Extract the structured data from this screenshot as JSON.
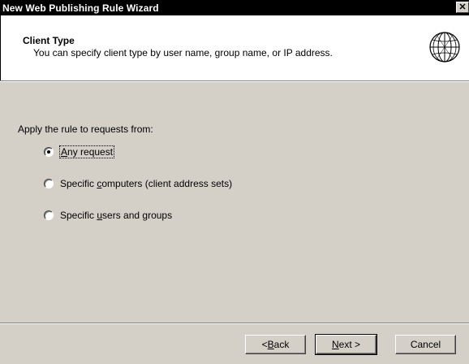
{
  "window": {
    "title": "New Web Publishing Rule Wizard",
    "close_glyph": "✕"
  },
  "header": {
    "title": "Client Type",
    "description": "You can specify client type by user name, group name, or IP address.",
    "icon": "globe-icon"
  },
  "body": {
    "prompt": "Apply the rule to requests from:",
    "options": [
      {
        "prefix": "",
        "accel": "A",
        "suffix": "ny request",
        "checked": true
      },
      {
        "prefix": "Specific ",
        "accel": "c",
        "suffix": "omputers (client address sets)",
        "checked": false
      },
      {
        "prefix": "Specific ",
        "accel": "u",
        "suffix": "sers and groups",
        "checked": false
      }
    ]
  },
  "buttons": {
    "back": {
      "prefix": "< ",
      "accel": "B",
      "suffix": "ack"
    },
    "next": {
      "prefix": "",
      "accel": "N",
      "suffix": "ext >"
    },
    "cancel": "Cancel"
  }
}
